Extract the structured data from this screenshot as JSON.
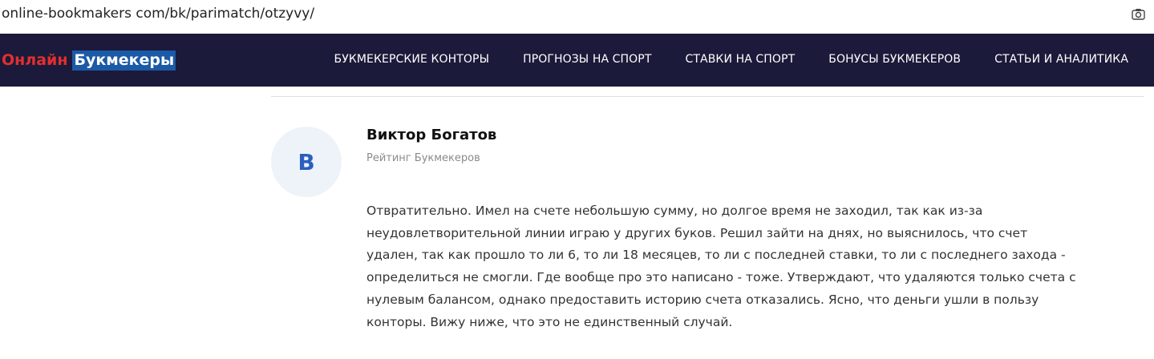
{
  "browser": {
    "url": "online-bookmakers com/bk/parimatch/otzyvy/",
    "screenshot_icon": "camera-icon"
  },
  "header": {
    "logo": {
      "part1": "Онлайн",
      "part2": "Букмекеры"
    },
    "menu": [
      {
        "label": "БУКМЕКЕРСКИЕ КОНТОРЫ"
      },
      {
        "label": "ПРОГНОЗЫ НА СПОРТ"
      },
      {
        "label": "СТАВКИ НА СПОРТ"
      },
      {
        "label": "БОНУСЫ БУКМЕКЕРОВ"
      },
      {
        "label": "СТАТЬИ И АНАЛИТИКА"
      }
    ],
    "colors": {
      "background": "#1c1a3a",
      "logo_red": "#e03030",
      "logo_blue": "#1b5aa6"
    }
  },
  "review": {
    "avatar_letter": "В",
    "author": "Виктор Богатов",
    "source": "Рейтинг Букмекеров",
    "lines": [
      "Отвратительно. Имел на счете небольшую сумму, но долгое время не заходил, так как из-за",
      "неудовлетворительной линии играю у других буков. Решил зайти на днях, но выяснилось, что счет",
      "удален, так как прошло то ли 6, то ли 18 месяцев, то ли с последней ставки, то ли с последнего захода -",
      "определиться не смогли. Где вообще про это написано - тоже. Утверждают, что удаляются только счета с",
      "нулевым балансом, однако предоставить историю счета отказались. Ясно, что деньги ушли в пользу",
      "конторы. Вижу ниже, что это не единственный случай."
    ]
  }
}
